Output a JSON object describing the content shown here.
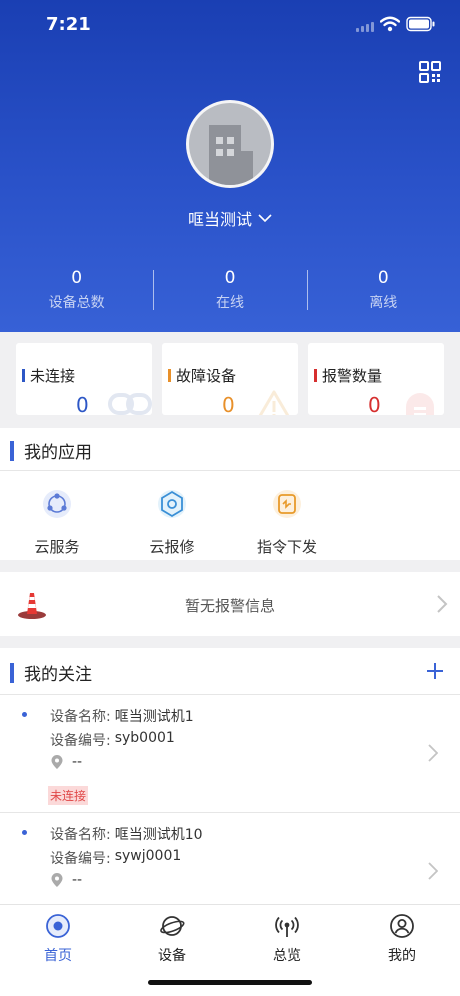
{
  "status_bar": {
    "time": "7:21"
  },
  "header": {
    "company_name": "哐当测试",
    "icons": {
      "qr": "qr-code-icon",
      "dropdown": "chevron-down-icon",
      "avatar": "building-avatar"
    },
    "stats": [
      {
        "value": "0",
        "label": "设备总数"
      },
      {
        "value": "0",
        "label": "在线"
      },
      {
        "value": "0",
        "label": "离线"
      }
    ]
  },
  "status_cards": [
    {
      "label": "未连接",
      "value": "0",
      "color": "#2d57c6",
      "icon": "link-icon"
    },
    {
      "label": "故障设备",
      "value": "0",
      "color": "#e8902a",
      "icon": "warning-triangle-icon"
    },
    {
      "label": "报警数量",
      "value": "0",
      "color": "#d62f2f",
      "icon": "alarm-bell-icon"
    }
  ],
  "apps": {
    "title": "我的应用",
    "items": [
      {
        "label": "云服务",
        "icon": "cloud-service-icon"
      },
      {
        "label": "云报修",
        "icon": "cloud-repair-icon"
      },
      {
        "label": "指令下发",
        "icon": "command-dispatch-icon"
      }
    ]
  },
  "alarm": {
    "text": "暂无报警信息",
    "icon": "traffic-cone-icon"
  },
  "follow": {
    "title": "我的关注",
    "add_icon": "plus-icon",
    "devices": [
      {
        "name_label": "设备名称:",
        "name": "哐当测试机1",
        "code_label": "设备编号:",
        "code": "syb0001",
        "location": "--",
        "status": "未连接"
      },
      {
        "name_label": "设备名称:",
        "name": "哐当测试机10",
        "code_label": "设备编号:",
        "code": "sywj0001",
        "location": "--"
      }
    ]
  },
  "tabbar": {
    "active_color": "#3a63d6",
    "items": [
      {
        "label": "首页",
        "icon": "home-icon",
        "active": true
      },
      {
        "label": "设备",
        "icon": "planet-icon"
      },
      {
        "label": "总览",
        "icon": "broadcast-icon"
      },
      {
        "label": "我的",
        "icon": "user-icon"
      }
    ]
  }
}
